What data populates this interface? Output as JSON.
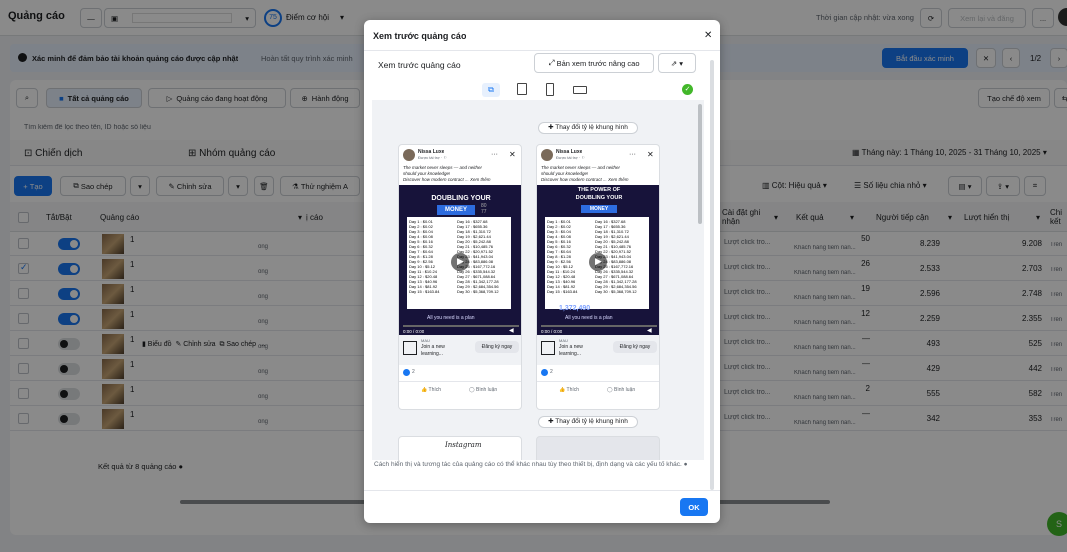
{
  "topbar": {
    "title": "Quảng cáo",
    "opportunity_score": "75",
    "opportunity_label": "Điểm cơ hội",
    "update_status": "Thời gian cập nhật: vừa xong",
    "review_publish": "Xem lại và đăng",
    "more": "..."
  },
  "banner": {
    "text": "Xác minh để đảm bảo tài khoản quảng cáo được cập nhật",
    "sub": "Hoàn tất quy trình xác minh",
    "action": "Bắt đầu xác minh",
    "pager": "1/2"
  },
  "filters": {
    "all_ads": "Tất cả quảng cáo",
    "active_ads": "Quảng cáo đang hoạt động",
    "actions": "Hành động",
    "create_view": "Tạo chế độ xem",
    "search_placeholder": "Tìm kiếm để lọc theo tên, ID hoặc số liệu"
  },
  "tabs": {
    "campaign": "Chiến dịch",
    "adset": "Nhóm quảng cáo",
    "date_range": "Tháng này: 1 Tháng 10, 2025 - 31 Tháng 10, 2025"
  },
  "toolbar": {
    "create": "Tạo",
    "duplicate": "Sao chép",
    "edit": "Chỉnh sửa",
    "ab_test": "Thử nghiệm A",
    "columns": "Cột: Hiệu quả",
    "breakdown": "Số liệu chia nhỏ"
  },
  "table": {
    "headers": {
      "toggle": "Tắt/Bật",
      "ad": "Quảng cáo",
      "cost_suffix": "ị cáo",
      "attribution": "Cài đặt ghi nhận",
      "results": "Kết quả",
      "reach": "Người tiếp cận",
      "impressions": "Lượt hiển thị",
      "cost_per": "Chi kết"
    },
    "rows": [
      {
        "name": "1",
        "on": true,
        "checked": false,
        "attr": "Lượt click tro...",
        "results": "50",
        "results_sub": "Khách hàng tiềm năn...",
        "reach": "8.239",
        "impressions": "9.208",
        "last": "Trên",
        "mid": "ông"
      },
      {
        "name": "1",
        "on": true,
        "checked": true,
        "attr": "Lượt click tro...",
        "results": "26",
        "results_sub": "Khách hàng tiềm năn...",
        "reach": "2.533",
        "impressions": "2.703",
        "last": "Trên",
        "mid": "ông"
      },
      {
        "name": "1",
        "on": true,
        "checked": false,
        "attr": "Lượt click tro...",
        "results": "19",
        "results_sub": "Khách hàng tiềm năn...",
        "reach": "2.596",
        "impressions": "2.748",
        "last": "Trên",
        "mid": "ông"
      },
      {
        "name": "1",
        "on": true,
        "checked": false,
        "attr": "Lượt click tro...",
        "results": "12",
        "results_sub": "Khách hàng tiềm năn...",
        "reach": "2.259",
        "impressions": "2.355",
        "last": "Trên",
        "mid": "ông"
      },
      {
        "name": "1",
        "on": false,
        "checked": false,
        "attr": "Lượt click tro...",
        "results": "—",
        "results_sub": "Khách hàng tiềm năn...",
        "reach": "493",
        "impressions": "525",
        "last": "Trên",
        "mid": "ông"
      },
      {
        "name": "1",
        "on": false,
        "checked": false,
        "attr": "Lượt click tro...",
        "results": "—",
        "results_sub": "Khách hàng tiềm năn...",
        "reach": "429",
        "impressions": "442",
        "last": "Trên",
        "mid": "ông"
      },
      {
        "name": "1",
        "on": false,
        "checked": false,
        "attr": "Lượt click tro...",
        "results": "2",
        "results_sub": "Khách hàng tiềm năn...",
        "reach": "555",
        "impressions": "582",
        "last": "Trên",
        "mid": "ông"
      },
      {
        "name": "1",
        "on": false,
        "checked": false,
        "attr": "Lượt click tro...",
        "results": "—",
        "results_sub": "Khách hàng tiềm năn...",
        "reach": "342",
        "impressions": "353",
        "last": "Trên",
        "mid": "ông"
      }
    ],
    "row_actions": {
      "chart": "Biểu đồ",
      "edit": "Chỉnh sửa",
      "duplicate": "Sao chép",
      "more": "..."
    },
    "footer": "Kết quả từ 8 quảng cáo"
  },
  "modal": {
    "title": "Xem trước quảng cáo",
    "subtitle": "Xem trước quảng cáo",
    "advanced": "Bản xem trước nâng cao",
    "change_ratio": "Thay đổi tỷ lệ khung hình",
    "disclaimer": "Cách hiển thị và tương tác của quảng cáo có thể khác nhau tùy theo thiết bị, định dạng và các yếu tố khác.",
    "ok": "OK",
    "instagram": "Instagram",
    "post": {
      "page_name": "Nissa Luxe",
      "sponsored": "Được tài trợ · ⚐",
      "caption1": "The market never sleeps — and neither",
      "caption2": "should your knowledge!",
      "caption3": "Discover how modern contract ... Xem thêm",
      "headline1": "DOUBLING YOUR",
      "headline2": "MONEY",
      "bubble_num": "80",
      "bubble_num2": "77",
      "days_left": "Day 1 : $0.01\nDay 2 : $0.02\nDay 3 : $0.04\nDay 4 : $0.08\nDay 5 : $0.16\nDay 6 : $0.32\nDay 7 : $0.64\nDay 8 : $1.28\nDay 9 : $2.56\nDay 10 : $5.12\nDay 11 : $10.24\nDay 12 : $20.48\nDay 13 : $40.96\nDay 14 : $81.92\nDay 15 : $163.84",
      "days_right": "Day 16 : $327.68\nDay 17 : $655.36\nDay 18 : $1,310.72\nDay 19 : $2,621.44\nDay 20 : $5,242.88\nDay 21 : $10,485.76\nDay 22 : $20,971.52\nDay 23 : $41,943.04\nDay 24 : $83,886.08\nDay 25 : $167,772.16\nDay 26 : $335,544.32\nDay 27 : $671,088.64\nDay 28 : $1,342,177.28\nDay 29 : $2,684,354.56\nDay 30 : $5,368,709.12",
      "time": "0:00 / 0:00",
      "plan_text": "All you need is a plan",
      "big_number": "1,372,490",
      "cta_small": "MAU",
      "cta_line1": "Join a new",
      "cta_line2": "learning...",
      "cta_button": "Đăng ký ngay",
      "likes": "2",
      "like": "Thích",
      "comment": "Bình luận",
      "headline1b": "THE POWER OF",
      "headline2b": "DOUBLING YOUR",
      "headline3b": "MONEY"
    }
  }
}
